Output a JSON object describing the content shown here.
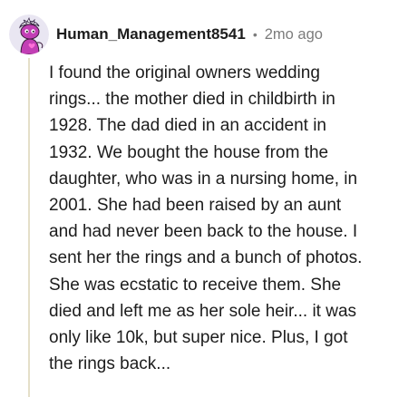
{
  "comment": {
    "username": "Human_Management8541",
    "separator": "•",
    "timestamp": "2mo ago",
    "avatar_icon": "snoo-avatar-icon",
    "body_lines": [
      "I found the original owners wedding",
      "rings... the mother died in childbirth in",
      "1928. The dad died in an accident in",
      "1932. We bought the house from the",
      "daughter, who was in a nursing home, in",
      "2001. She had been raised by an aunt",
      "and had never been back to the house. I",
      "sent her the rings and a bunch of photos.",
      "She was ecstatic to receive them. She",
      "died and left me as her sole heir... it was",
      "only like 10k, but super nice. Plus, I got",
      "the rings back..."
    ]
  },
  "colors": {
    "text": "#1c1c1c",
    "meta": "#7c7c7c",
    "thread_line": "#e5dfc9",
    "avatar_bg": "#e9e6f2",
    "avatar_body": "#c23fb5"
  }
}
